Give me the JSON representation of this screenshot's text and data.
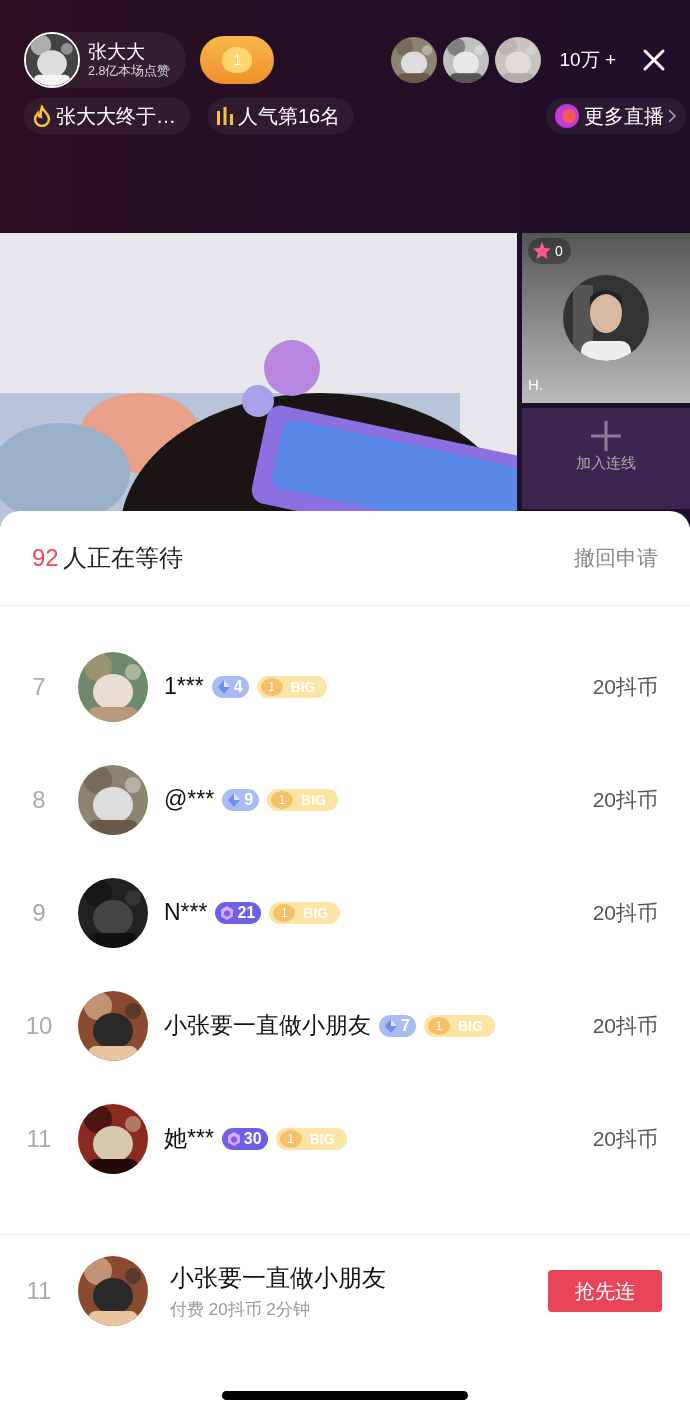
{
  "host": {
    "name": "张大大",
    "likes": "2.8亿本场点赞",
    "fan_level": "1"
  },
  "viewers": {
    "count": "10万 +"
  },
  "tags": [
    {
      "kind": "topic",
      "label": "张大大终于…"
    },
    {
      "kind": "rank",
      "label": "人气第16名"
    },
    {
      "kind": "more",
      "label": "更多直播"
    }
  ],
  "guest": {
    "stars": "0",
    "name": "H."
  },
  "join": {
    "label": "加入连线"
  },
  "queue": {
    "count": "92",
    "label": "人正在等待",
    "withdraw": "撤回申请"
  },
  "rows": [
    {
      "rank": "7",
      "name": "1***",
      "level": {
        "kind": "diamond",
        "value": "4"
      },
      "fan": {
        "value": "1",
        "label": "BIG"
      },
      "price": "20抖币"
    },
    {
      "rank": "8",
      "name": "@***",
      "level": {
        "kind": "diamond",
        "value": "9"
      },
      "fan": {
        "value": "1",
        "label": "BIG"
      },
      "price": "20抖币"
    },
    {
      "rank": "9",
      "name": "N***",
      "level": {
        "kind": "cube",
        "value": "21"
      },
      "fan": {
        "value": "1",
        "label": "BIG"
      },
      "price": "20抖币"
    },
    {
      "rank": "10",
      "name": "小张要一直做小朋友",
      "level": {
        "kind": "diamond",
        "value": "7"
      },
      "fan": {
        "value": "1",
        "label": "BIG"
      },
      "price": "20抖币"
    },
    {
      "rank": "11",
      "name": "她***",
      "level": {
        "kind": "cube",
        "value": "30"
      },
      "fan": {
        "value": "1",
        "label": "BIG"
      },
      "price": "20抖币"
    }
  ],
  "me": {
    "rank": "11",
    "name": "小张要一直做小朋友",
    "detail": "付费 20抖币 2分钟",
    "button": "抢先连"
  }
}
